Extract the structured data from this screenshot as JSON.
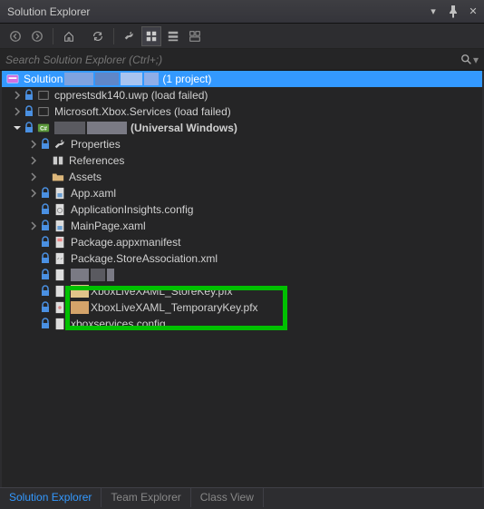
{
  "title": "Solution Explorer",
  "search": {
    "placeholder": "Search Solution Explorer (Ctrl+;)"
  },
  "solution": {
    "label_prefix": "Solution",
    "label_suffix": "(1 project)"
  },
  "nodes": {
    "cpp": "cpprestsdk140.uwp (load failed)",
    "xbox_services": "Microsoft.Xbox.Services (load failed)",
    "project_suffix": "(Universal Windows)",
    "properties": "Properties",
    "references": "References",
    "assets": "Assets",
    "app_xaml": "App.xaml",
    "appinsights": "ApplicationInsights.config",
    "mainpage": "MainPage.xaml",
    "pkg_manifest": "Package.appxmanifest",
    "pkg_store": "Package.StoreAssociation.xml",
    "key_store": "XboxLiveXAML_StoreKey.pfx",
    "key_temp": "XboxLiveXAML_TemporaryKey.pfx",
    "xbox_config": "xboxservices.config"
  },
  "tabs": {
    "solution": "Solution Explorer",
    "team": "Team Explorer",
    "class": "Class View"
  },
  "colors": {
    "blur1": "#7fa3e0",
    "blur2": "#5f87c9",
    "blur3": "#a8c4f0",
    "blur4": "#8faee8",
    "blur_proj1": "#5a5a60",
    "blur_proj2": "#7a7a84",
    "h1": "#e2c48a",
    "h2": "#d4a36a"
  }
}
